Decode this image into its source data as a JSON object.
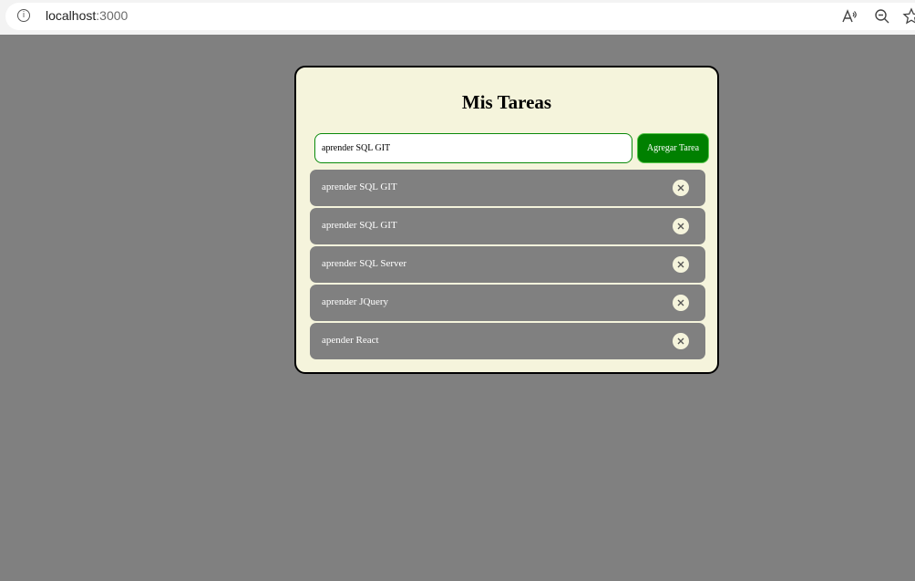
{
  "browser": {
    "url_host": "localhost",
    "url_port": ":3000"
  },
  "app": {
    "title": "Mis Tareas",
    "input": {
      "value": "aprender SQL GIT",
      "placeholder": ""
    },
    "add_button_label": "Agregar Tarea",
    "tasks": [
      {
        "text": "aprender SQL GIT"
      },
      {
        "text": "aprender SQL GIT"
      },
      {
        "text": "aprender SQL Server"
      },
      {
        "text": "aprender JQuery"
      },
      {
        "text": "apender React"
      }
    ]
  },
  "icons": {
    "info": "info-icon",
    "read_aloud": "read-aloud-icon",
    "zoom": "zoom-out-icon",
    "favorite": "favorite-star-icon",
    "delete": "close-icon"
  },
  "colors": {
    "page_background": "#808080",
    "card_background": "#f5f4dc",
    "add_button": "#008000",
    "task_item": "#808080"
  }
}
